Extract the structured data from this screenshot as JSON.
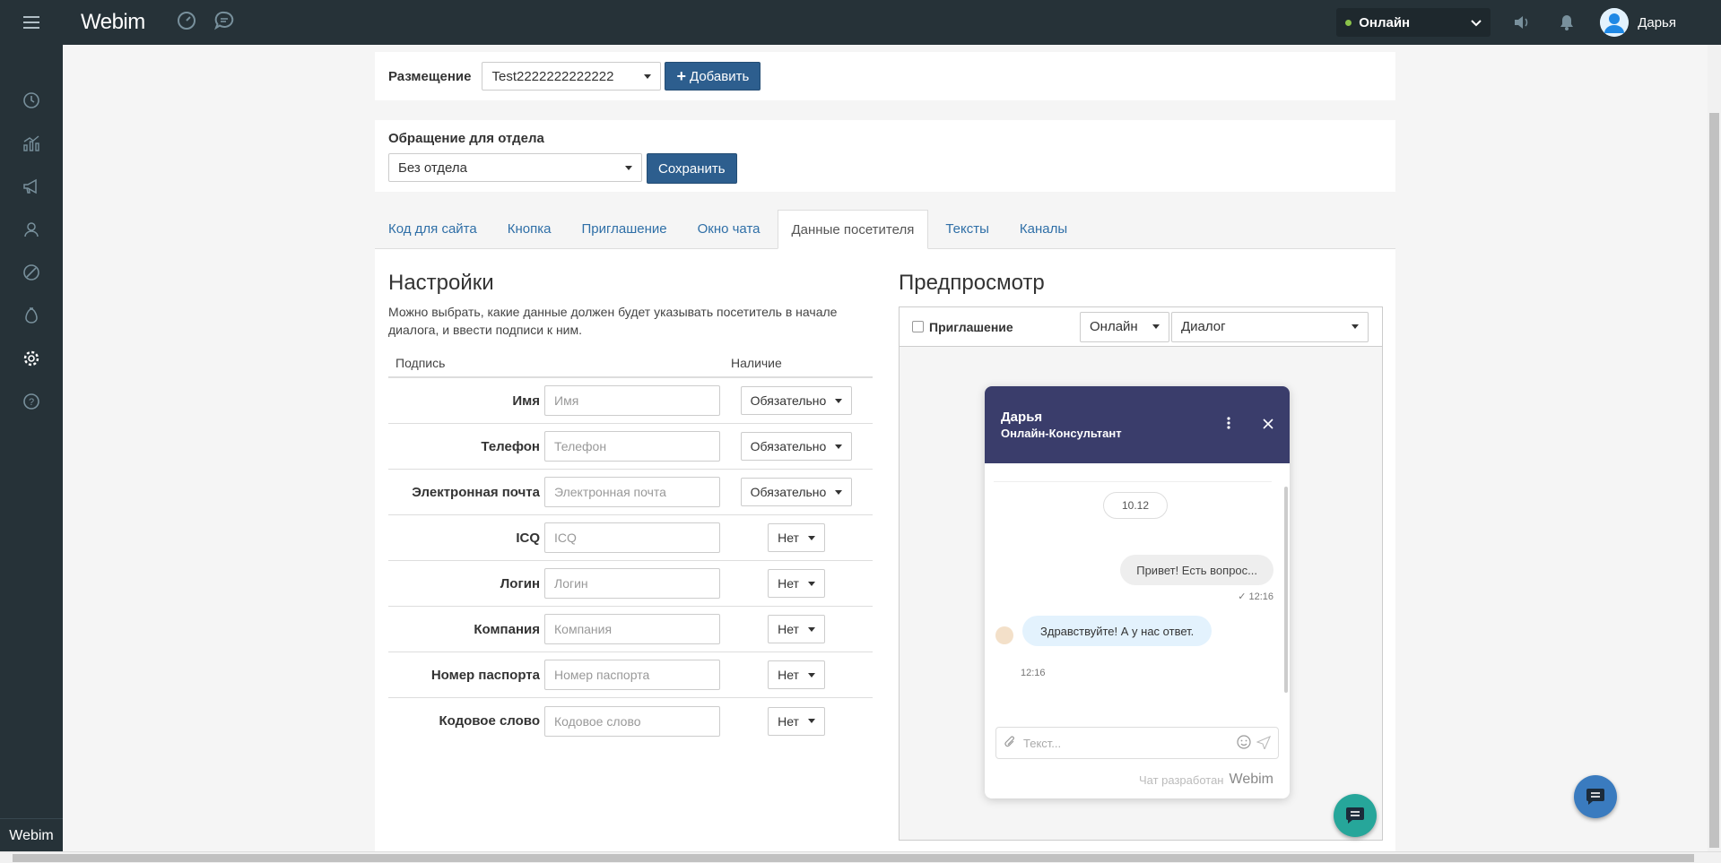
{
  "topbar": {
    "logo_text": "Webim",
    "status": "Онлайн",
    "user_name": "Дарья"
  },
  "sidebar": {
    "logo_text": "Webim",
    "icons": [
      "history-icon",
      "stats-icon",
      "campaign-icon",
      "visitors-icon",
      "block-icon",
      "money-icon",
      "settings-icon",
      "help-icon"
    ]
  },
  "placement": {
    "label": "Размещение",
    "selected": "Test2222222222222",
    "add_button": "Добавить"
  },
  "department": {
    "label": "Обращение для отдела",
    "selected": "Без отдела",
    "save_button": "Сохранить"
  },
  "tabs": [
    {
      "label": "Код для сайта"
    },
    {
      "label": "Кнопка"
    },
    {
      "label": "Приглашение"
    },
    {
      "label": "Окно чата"
    },
    {
      "label": "Данные посетителя"
    },
    {
      "label": "Тексты"
    },
    {
      "label": "Каналы"
    }
  ],
  "settings": {
    "title": "Настройки",
    "description": "Можно выбрать, какие данные должен будет указывать посетитель в начале диалога, и ввести подписи к ним.",
    "col_signature": "Подпись",
    "col_presence": "Наличие",
    "rows": [
      {
        "label": "Имя",
        "placeholder": "Имя",
        "presence": "Обязательно"
      },
      {
        "label": "Телефон",
        "placeholder": "Телефон",
        "presence": "Обязательно"
      },
      {
        "label": "Электронная почта",
        "placeholder": "Электронная почта",
        "presence": "Обязательно"
      },
      {
        "label": "ICQ",
        "placeholder": "ICQ",
        "presence": "Нет"
      },
      {
        "label": "Логин",
        "placeholder": "Логин",
        "presence": "Нет"
      },
      {
        "label": "Компания",
        "placeholder": "Компания",
        "presence": "Нет"
      },
      {
        "label": "Номер паспорта",
        "placeholder": "Номер паспорта",
        "presence": "Нет"
      },
      {
        "label": "Кодовое слово",
        "placeholder": "Кодовое слово",
        "presence": "Нет"
      }
    ]
  },
  "preview": {
    "title": "Предпросмотр",
    "invite_label": "Приглашение",
    "mode": "Онлайн",
    "view": "Диалог",
    "chat": {
      "operator_name": "Дарья",
      "operator_role": "Онлайн-Консультант",
      "date": "10.12",
      "visitor_message": "Привет! Есть вопрос...",
      "visitor_time": "12:16",
      "operator_message": "Здравствуйте! А у нас ответ.",
      "operator_time": "12:16",
      "input_placeholder": "Текст...",
      "footer": "Чат разработан",
      "footer_brand": "Webim"
    }
  }
}
